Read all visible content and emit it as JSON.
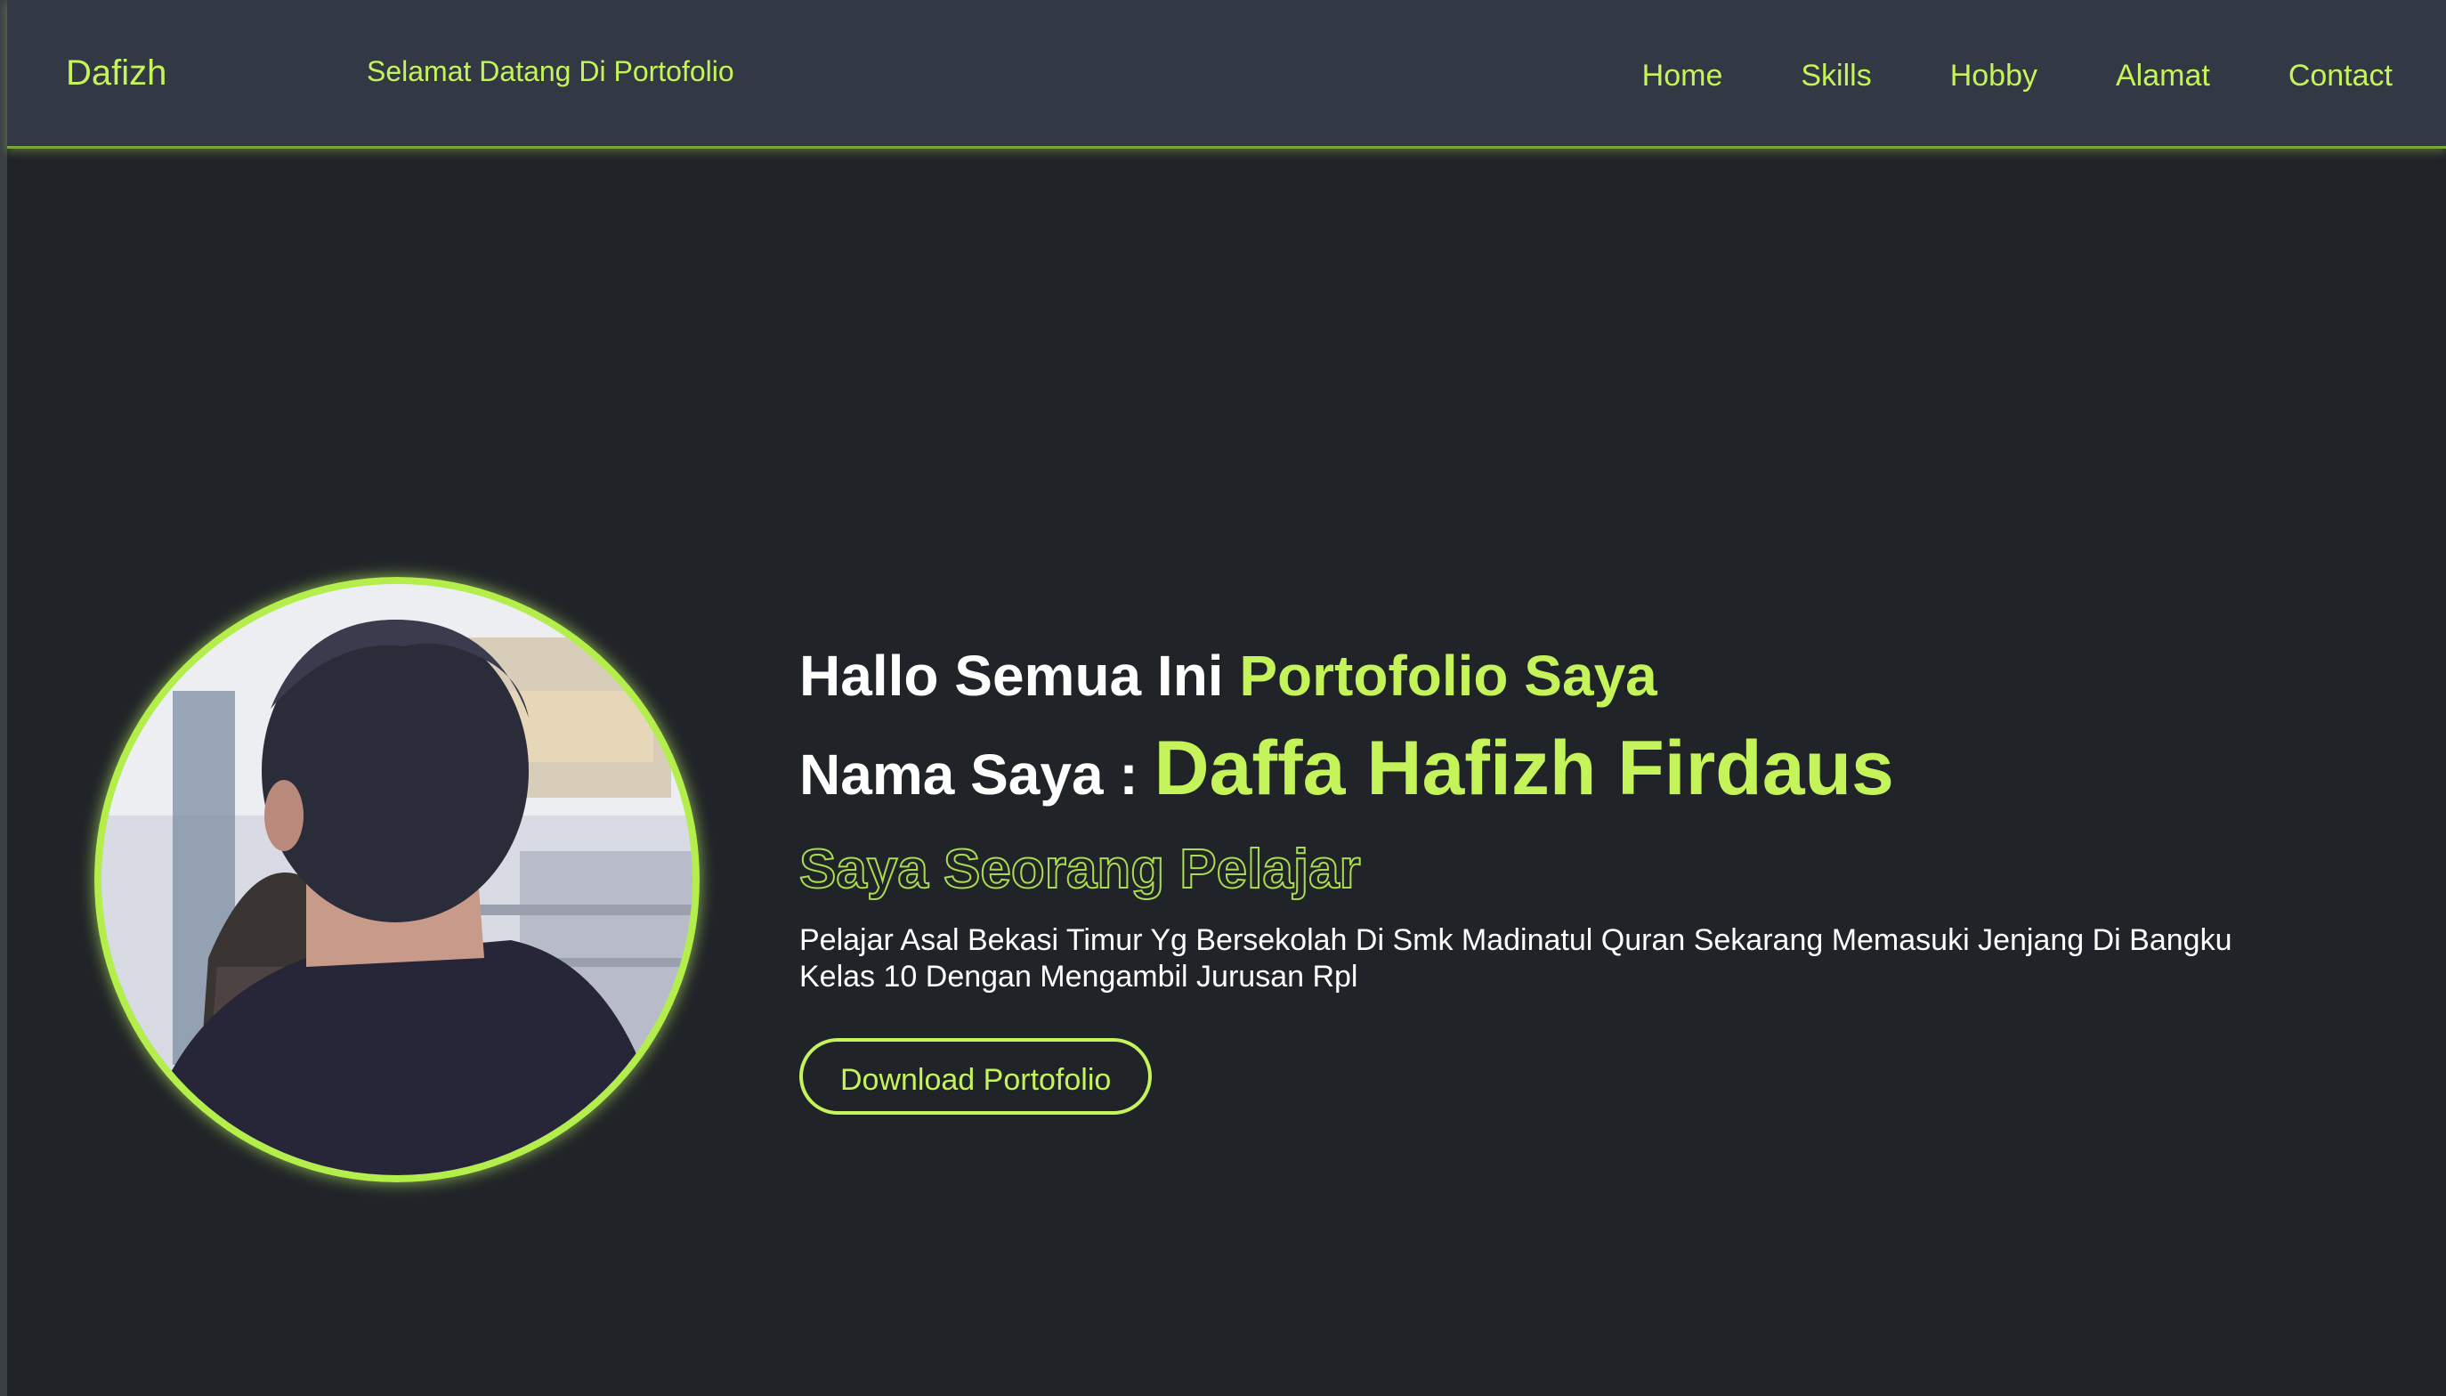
{
  "navbar": {
    "brand": "Dafizh",
    "marquee_text": "Selamat Datang Di Portofolio",
    "links": [
      "Home",
      "Skills",
      "Hobby",
      "Alamat",
      "Contact"
    ]
  },
  "hero": {
    "greeting_prefix": "Hallo Semua Ini",
    "greeting_accent": "Portofolio Saya",
    "name_label": "Nama Saya :",
    "name": "Daffa Hafizh Firdaus",
    "role": "Saya Seorang Pelajar",
    "description": "Pelajar Asal Bekasi Timur Yg Bersekolah Di Smk Madinatul Quran Sekarang Memasuki Jenjang Di Bangku Kelas 10 Dengan Mengambil Jurusan Rpl",
    "download_label": "Download Portofolio"
  },
  "colors": {
    "accent": "#c4f35a",
    "background": "#202328",
    "navbar": "#323844"
  },
  "icons": {
    "profile_photo": "profile-photo"
  }
}
